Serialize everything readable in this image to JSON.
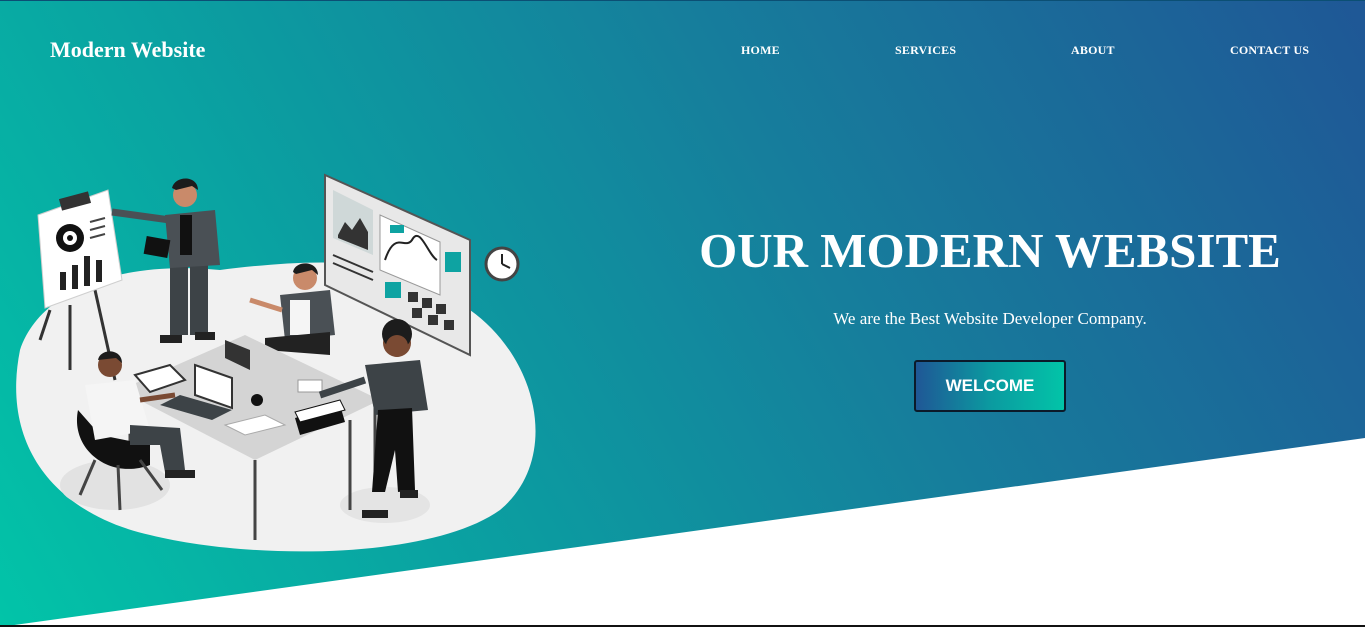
{
  "brand": {
    "name": "Modern Website"
  },
  "nav": {
    "items": [
      {
        "label": "HOME"
      },
      {
        "label": "SERVICES"
      },
      {
        "label": "ABOUT"
      },
      {
        "label": "CONTACT US"
      }
    ]
  },
  "hero": {
    "title": "OUR MODERN WEBSITE",
    "subtitle": "We are the Best Website Developer Company.",
    "cta_label": "WELCOME"
  },
  "illustration": {
    "icon": "office-team-meeting-illustration"
  },
  "colors": {
    "gradient_start": "#02c4a8",
    "gradient_end": "#1f5796",
    "text": "#ffffff"
  }
}
